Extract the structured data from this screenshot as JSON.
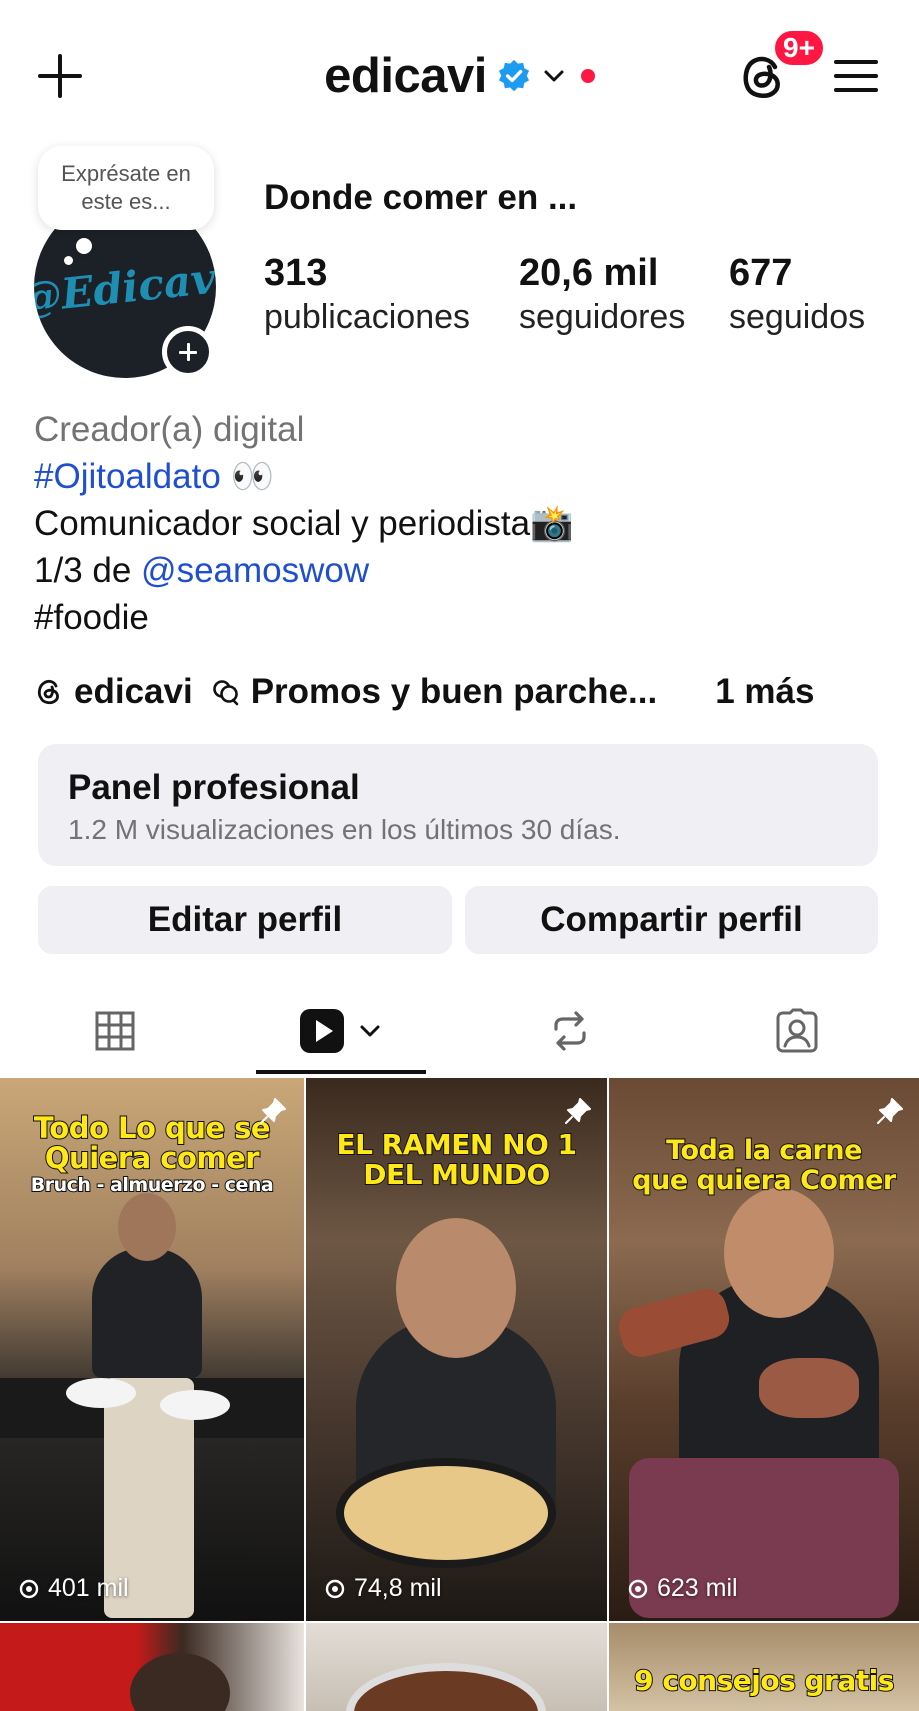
{
  "header": {
    "username": "edicavi",
    "notif_badge": "9+",
    "icons": [
      "plus-icon",
      "verified-badge-icon",
      "chevron-down-icon",
      "threads-icon",
      "menu-icon"
    ]
  },
  "profile": {
    "note": "Exprésate en este es...",
    "avatar_text": "@Edicavi",
    "name": "Donde comer en ...",
    "stats": [
      {
        "value": "313",
        "label": "publicaciones"
      },
      {
        "value": "20,6 mil",
        "label": "seguidores"
      },
      {
        "value": "677",
        "label": "seguidos"
      }
    ]
  },
  "bio": {
    "category": "Creador(a) digital",
    "hashtag": "#Ojitoaldato",
    "hashtag_emoji": "👀",
    "line2": "Comunicador social y periodista",
    "line2_emoji": "📸",
    "line3_prefix": "1/3 de ",
    "line3_mention": "@seamoswow",
    "line4": "#foodie"
  },
  "links": {
    "threads": "edicavi",
    "channel": "Promos y buen parche...",
    "more": "1 más"
  },
  "panel": {
    "title": "Panel profesional",
    "subtitle": "1.2 M visualizaciones en los últimos 30 días."
  },
  "buttons": {
    "edit": "Editar perfil",
    "share": "Compartir perfil"
  },
  "tabs": [
    "grid-icon",
    "reels-icon",
    "reposts-icon",
    "tagged-icon"
  ],
  "posts": [
    {
      "caption1": "Todo Lo que se",
      "caption2": "Quiera comer",
      "caption3": "Bruch - almuerzo - cena",
      "views": "401 mil"
    },
    {
      "caption1": "EL RAMEN NO 1",
      "caption2": "DEL MUNDO",
      "caption3": "",
      "views": "74,8 mil"
    },
    {
      "caption1": "Toda la carne",
      "caption2": "que quiera Comer",
      "caption3": "",
      "views": "623 mil"
    },
    {
      "caption1": "",
      "caption2": "",
      "caption3": "",
      "views": ""
    },
    {
      "caption1": "",
      "caption2": "",
      "caption3": "",
      "views": ""
    },
    {
      "caption1": "9 consejos gratis",
      "caption2": "",
      "caption3": "",
      "views": ""
    }
  ]
}
